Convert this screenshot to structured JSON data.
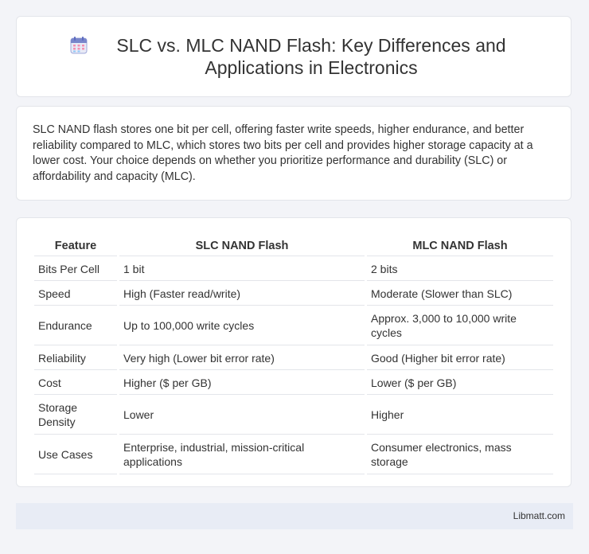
{
  "header": {
    "title": "SLC vs. MLC NAND Flash: Key Differences and Applications in Electronics",
    "icon": "calendar-icon"
  },
  "summary": "SLC NAND flash stores one bit per cell, offering faster write speeds, higher endurance, and better reliability compared to MLC, which stores two bits per cell and provides higher storage capacity at a lower cost. Your choice depends on whether you prioritize performance and durability (SLC) or affordability and capacity (MLC).",
  "table": {
    "headers": [
      "Feature",
      "SLC NAND Flash",
      "MLC NAND Flash"
    ],
    "rows": [
      [
        "Bits Per Cell",
        "1 bit",
        "2 bits"
      ],
      [
        "Speed",
        "High (Faster read/write)",
        "Moderate (Slower than SLC)"
      ],
      [
        "Endurance",
        "Up to 100,000 write cycles",
        "Approx. 3,000 to 10,000 write cycles"
      ],
      [
        "Reliability",
        "Very high (Lower bit error rate)",
        "Good (Higher bit error rate)"
      ],
      [
        "Cost",
        "Higher ($ per GB)",
        "Lower ($ per GB)"
      ],
      [
        "Storage Density",
        "Lower",
        "Higher"
      ],
      [
        "Use Cases",
        "Enterprise, industrial, mission-critical applications",
        "Consumer electronics, mass storage"
      ]
    ]
  },
  "footer": {
    "brand": "Libmatt.com"
  }
}
